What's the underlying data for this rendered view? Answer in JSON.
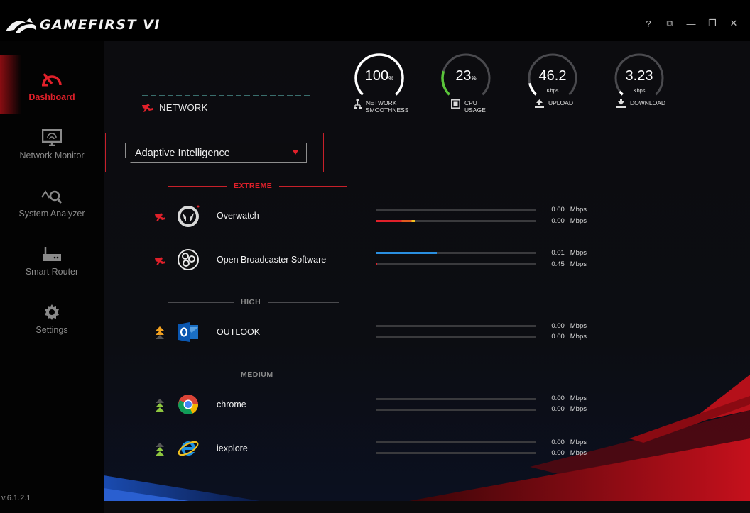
{
  "app": {
    "title": "GAMEFIRST VI",
    "version": "v.6.1.2.1",
    "window_controls": [
      {
        "name": "help-icon",
        "glyph": "?"
      },
      {
        "name": "mini-mode-icon",
        "glyph": "⧉"
      },
      {
        "name": "minimize-icon",
        "glyph": "—"
      },
      {
        "name": "restore-icon",
        "glyph": "❐"
      },
      {
        "name": "close-icon",
        "glyph": "✕"
      }
    ]
  },
  "sidebar": {
    "items": [
      {
        "label": "Dashboard",
        "icon": "dashboard-gauge-icon",
        "active": true
      },
      {
        "label": "Network Monitor",
        "icon": "monitor-icon",
        "active": false
      },
      {
        "label": "System Analyzer",
        "icon": "analyzer-icon",
        "active": false
      },
      {
        "label": "Smart Router",
        "icon": "router-icon",
        "active": false
      },
      {
        "label": "Settings",
        "icon": "gear-icon",
        "active": false
      }
    ]
  },
  "header": {
    "network_label": "NETWORK",
    "gauges": [
      {
        "id": "network-smoothness",
        "value": "100",
        "suffix": "%",
        "unit": "",
        "caption": [
          "NETWORK",
          "SMOOTHNESS"
        ],
        "level": 1.0,
        "color": "#ffffff",
        "icon": "network-node-icon"
      },
      {
        "id": "cpu-usage",
        "value": "23",
        "suffix": "%",
        "unit": "",
        "caption": [
          "CPU",
          "USAGE"
        ],
        "level": 0.23,
        "color": "#5ac53a",
        "icon": "cpu-chip-icon"
      },
      {
        "id": "upload",
        "value": "46.2",
        "suffix": "",
        "unit": "Kbps",
        "caption": [
          "UPLOAD"
        ],
        "level": 0.12,
        "color": "#ffffff",
        "icon": "upload-icon"
      },
      {
        "id": "download",
        "value": "3.23",
        "suffix": "",
        "unit": "Kbps",
        "caption": [
          "DOWNLOAD"
        ],
        "level": 0.04,
        "color": "#ffffff",
        "icon": "download-icon"
      }
    ]
  },
  "mode_select": {
    "value": "Adaptive Intelligence"
  },
  "sections": [
    {
      "label": "EXTREME",
      "color": "#e0202a"
    },
    {
      "label": "HIGH",
      "color": "#8a8a8a"
    },
    {
      "label": "MEDIUM",
      "color": "#8a8a8a"
    }
  ],
  "apps": [
    {
      "name": "Overwatch",
      "icon": "overwatch-icon",
      "priority": "extreme",
      "up": "0.00",
      "down": "0.00",
      "unit": "Mbps",
      "up_fill": 0.0,
      "down_fill": 0.25,
      "up_color": "#2a8fe0",
      "down_color": "#e0202a"
    },
    {
      "name": "Open Broadcaster Software",
      "icon": "obs-icon",
      "priority": "extreme",
      "up": "0.01",
      "down": "0.45",
      "unit": "Mbps",
      "up_fill": 0.38,
      "down_fill": 0.01,
      "up_color": "#2a8fe0",
      "down_color": "#e0202a"
    },
    {
      "name": "OUTLOOK",
      "icon": "outlook-icon",
      "priority": "high",
      "up": "0.00",
      "down": "0.00",
      "unit": "Mbps",
      "up_fill": 0,
      "down_fill": 0,
      "up_color": "#2a8fe0",
      "down_color": "#e0202a"
    },
    {
      "name": "chrome",
      "icon": "chrome-icon",
      "priority": "medium",
      "up": "0.00",
      "down": "0.00",
      "unit": "Mbps",
      "up_fill": 0,
      "down_fill": 0,
      "up_color": "#2a8fe0",
      "down_color": "#e0202a"
    },
    {
      "name": "iexplore",
      "icon": "iexplore-icon",
      "priority": "medium",
      "up": "0.00",
      "down": "0.00",
      "unit": "Mbps",
      "up_fill": 0,
      "down_fill": 0,
      "up_color": "#2a8fe0",
      "down_color": "#e0202a"
    }
  ],
  "colors": {
    "accent": "#e0202a",
    "upload_bar": "#2a8fe0",
    "high_priority": "#f0a020",
    "medium_priority": "#8ec63f"
  }
}
